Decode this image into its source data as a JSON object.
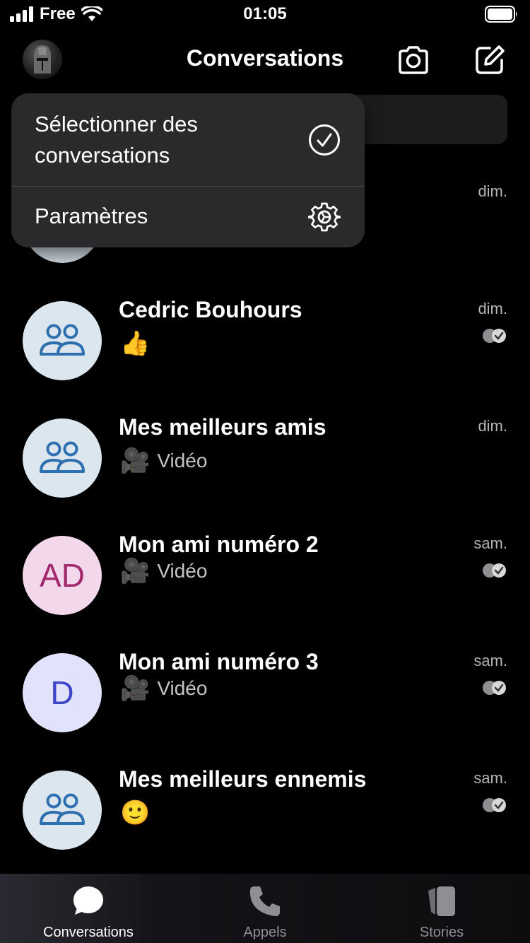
{
  "status_bar": {
    "carrier": "Free",
    "time": "01:05"
  },
  "header": {
    "title": "Conversations"
  },
  "menu": {
    "select_label": "Sélectionner des conversations",
    "settings_label": "Paramètres"
  },
  "conversations": [
    {
      "name": "",
      "date": "dim.",
      "preview": "",
      "avatar_text": "",
      "avatar_type": "group"
    },
    {
      "name": "Cedric Bouhours",
      "date": "dim.",
      "preview": "",
      "emoji": "👍",
      "avatar_type": "group",
      "read": true
    },
    {
      "name": "Mes meilleurs amis",
      "date": "dim.",
      "preview": "Vidéo",
      "emoji": "🎥",
      "avatar_type": "group",
      "read": false
    },
    {
      "name": "Mon ami numéro 2",
      "date": "sam.",
      "preview": "Vidéo",
      "emoji": "🎥",
      "avatar_text": "AD",
      "avatar_type": "initials",
      "avatar_bg": "#f3d7ea",
      "avatar_fg": "#a3296f",
      "read": true
    },
    {
      "name": "Mon ami numéro 3",
      "date": "sam.",
      "preview": "Vidéo",
      "emoji": "🎥",
      "avatar_text": "D",
      "avatar_type": "initials",
      "avatar_bg": "#e1e2fb",
      "avatar_fg": "#3e45c9",
      "read": true
    },
    {
      "name": "Mes meilleurs ennemis",
      "date": "sam.",
      "preview": "",
      "emoji": "🙂",
      "avatar_type": "group",
      "read": true
    }
  ],
  "tabs": [
    {
      "label": "Conversations",
      "icon": "chat-bubble-icon",
      "active": true
    },
    {
      "label": "Appels",
      "icon": "phone-icon",
      "active": false
    },
    {
      "label": "Stories",
      "icon": "stories-icon",
      "active": false
    }
  ],
  "colors": {
    "group_avatar_bg": "#dce6ee",
    "group_avatar_fg": "#2e6fb0",
    "menu_bg": "#2a2a2c",
    "inactive_tab": "#8e8e93"
  }
}
